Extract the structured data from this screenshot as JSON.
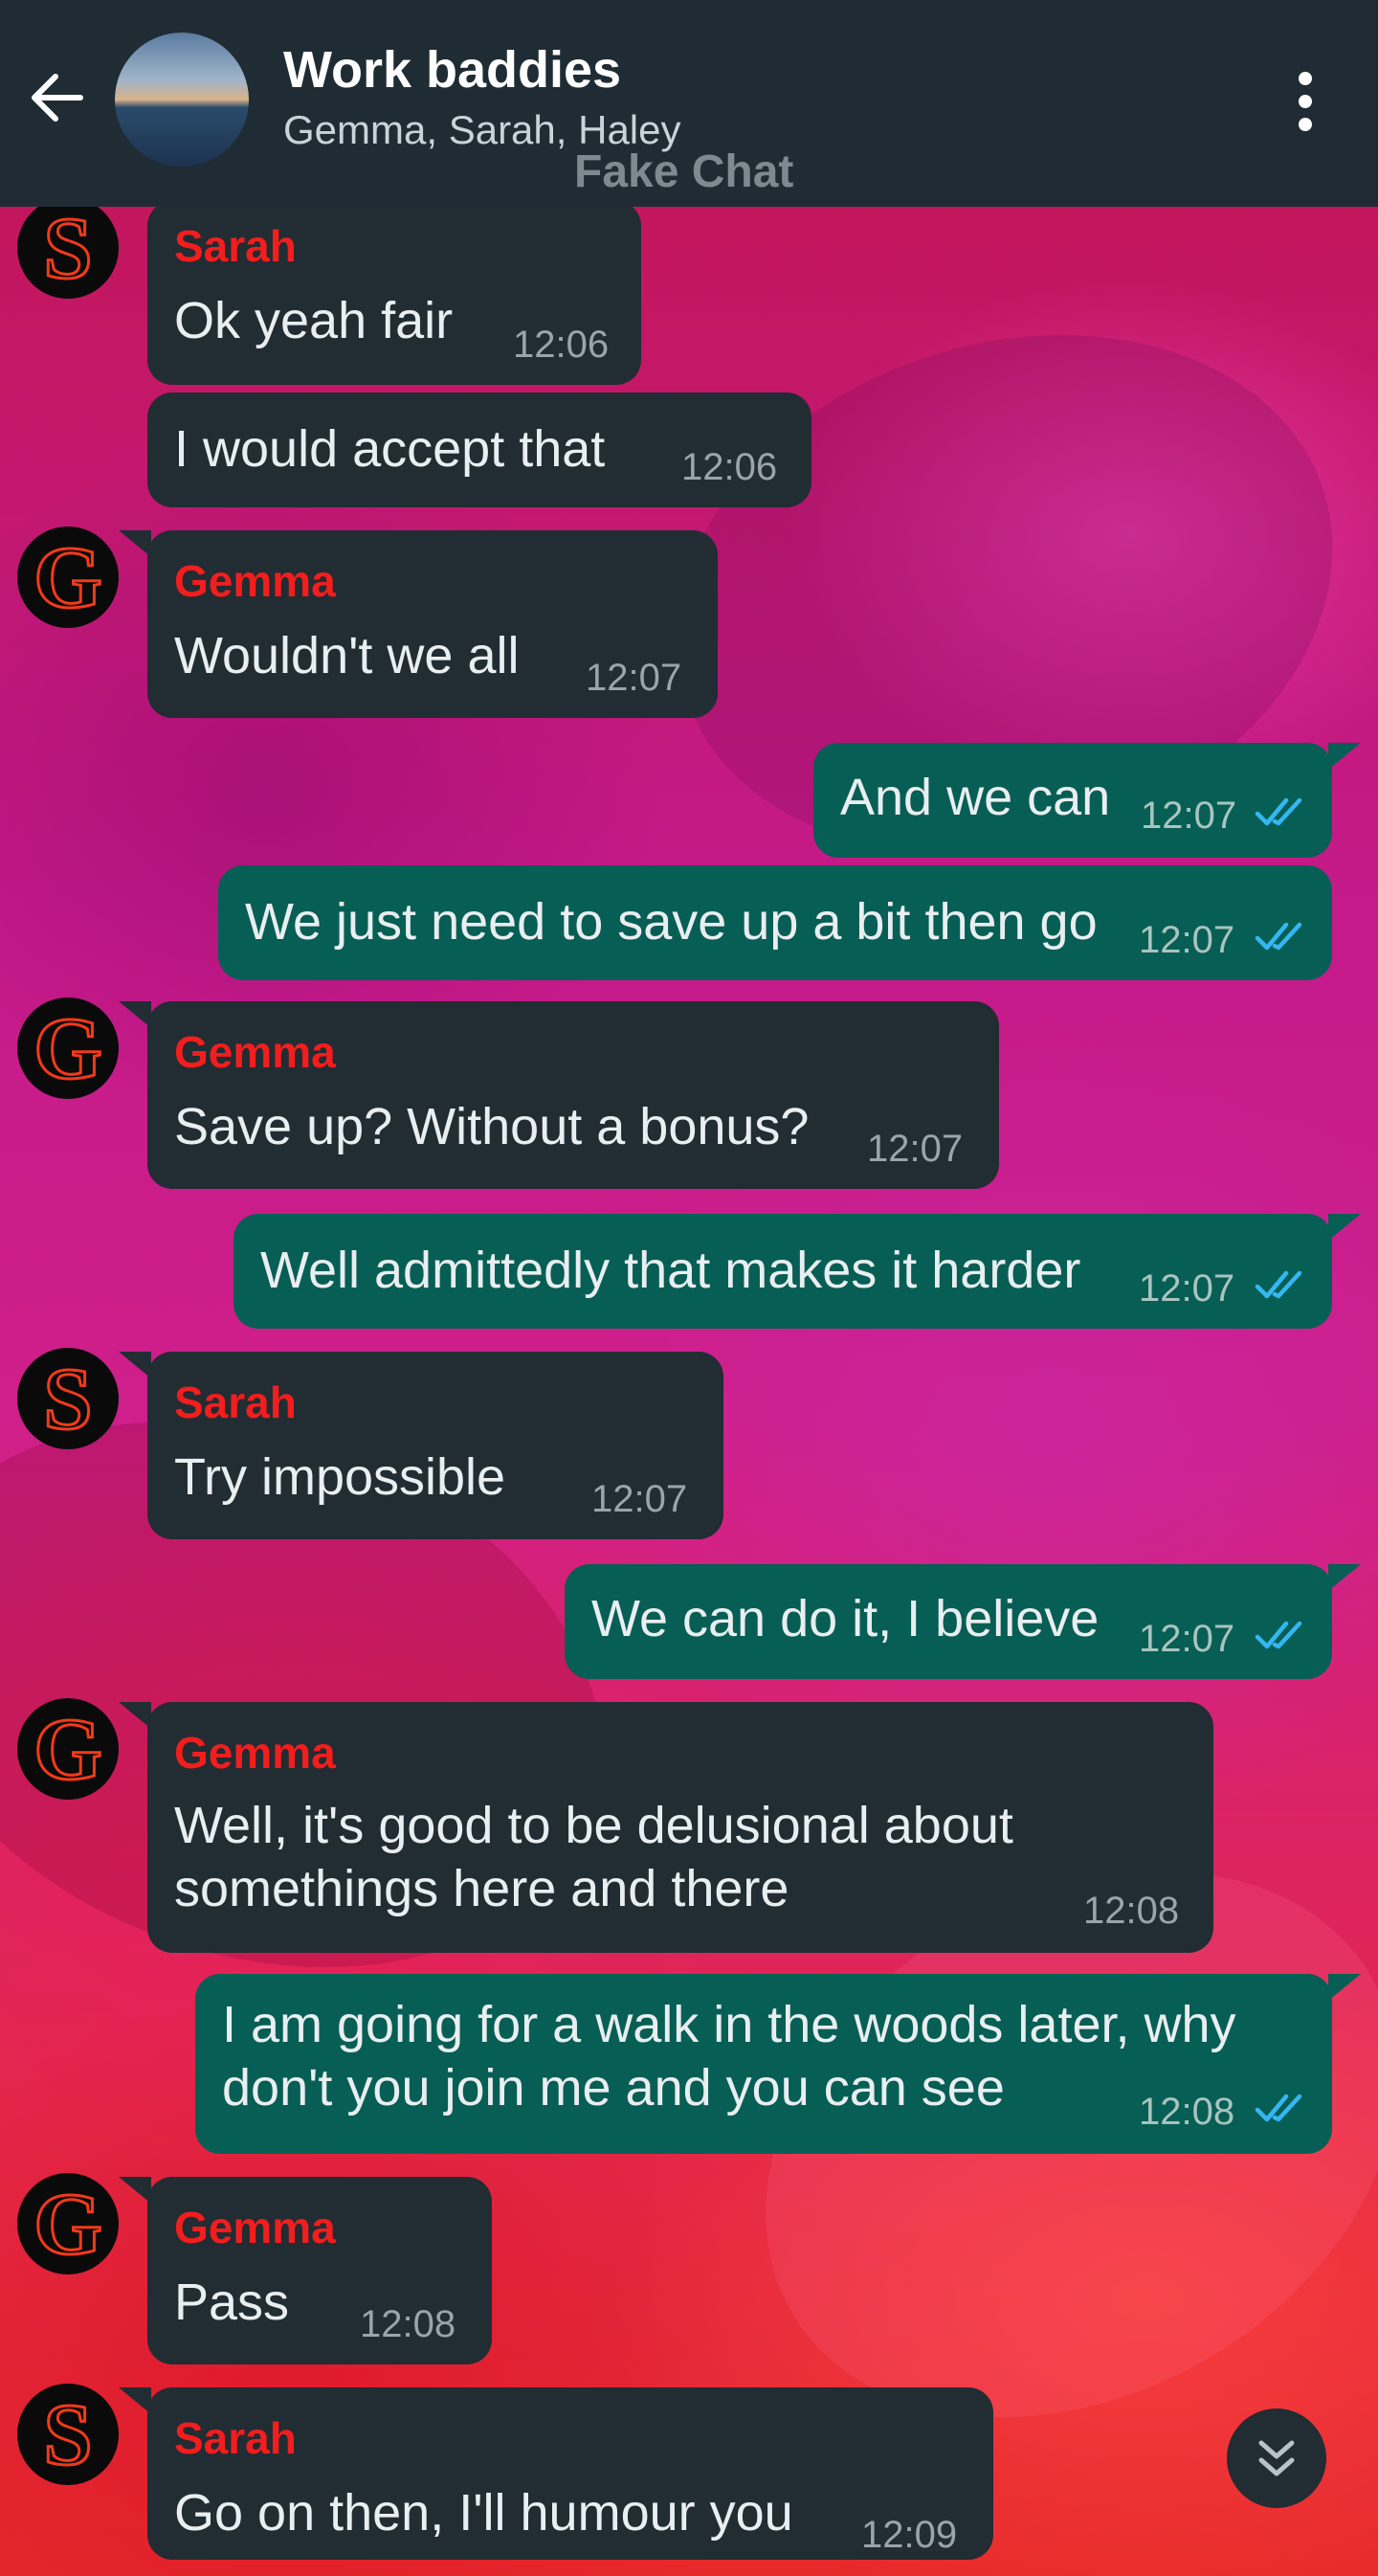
{
  "header": {
    "title": "Work baddies",
    "subtitle": "Gemma, Sarah, Haley",
    "watermark": "Fake Chat"
  },
  "colors": {
    "header_bg": "#1f2c34",
    "incoming_bubble": "#212c33",
    "outgoing_bubble": "#075e54",
    "sender_name": "#f21d1d",
    "read_ticks": "#34b7f1"
  },
  "messages": [
    {
      "sender": "Sarah",
      "avatar": "S",
      "text": "Ok yeah fair",
      "time": "12:06"
    },
    {
      "text": "I would accept that",
      "time": "12:06"
    },
    {
      "sender": "Gemma",
      "avatar": "G",
      "text": "Wouldn't we all",
      "time": "12:07"
    },
    {
      "text": "And we can",
      "time": "12:07",
      "status": "read"
    },
    {
      "text": "We just need to save up a bit then go",
      "time": "12:07",
      "status": "read"
    },
    {
      "sender": "Gemma",
      "avatar": "G",
      "text": "Save up? Without a bonus?",
      "time": "12:07"
    },
    {
      "text": "Well admittedly that makes it harder",
      "time": "12:07",
      "status": "read"
    },
    {
      "sender": "Sarah",
      "avatar": "S",
      "text": "Try impossible",
      "time": "12:07"
    },
    {
      "text": "We can do it, I believe",
      "time": "12:07",
      "status": "read"
    },
    {
      "sender": "Gemma",
      "avatar": "G",
      "text_line1": "Well, it's good to be delusional about",
      "text_line2": "somethings here and there",
      "time": "12:08"
    },
    {
      "text_line1": "I am going for a walk in the woods later, why",
      "text_line2": "don't you join me and you can see",
      "time": "12:08",
      "status": "read"
    },
    {
      "sender": "Gemma",
      "avatar": "G",
      "text": "Pass",
      "time": "12:08"
    },
    {
      "sender": "Sarah",
      "avatar": "S",
      "text": "Go on then, I'll humour you",
      "time": "12:09"
    }
  ]
}
